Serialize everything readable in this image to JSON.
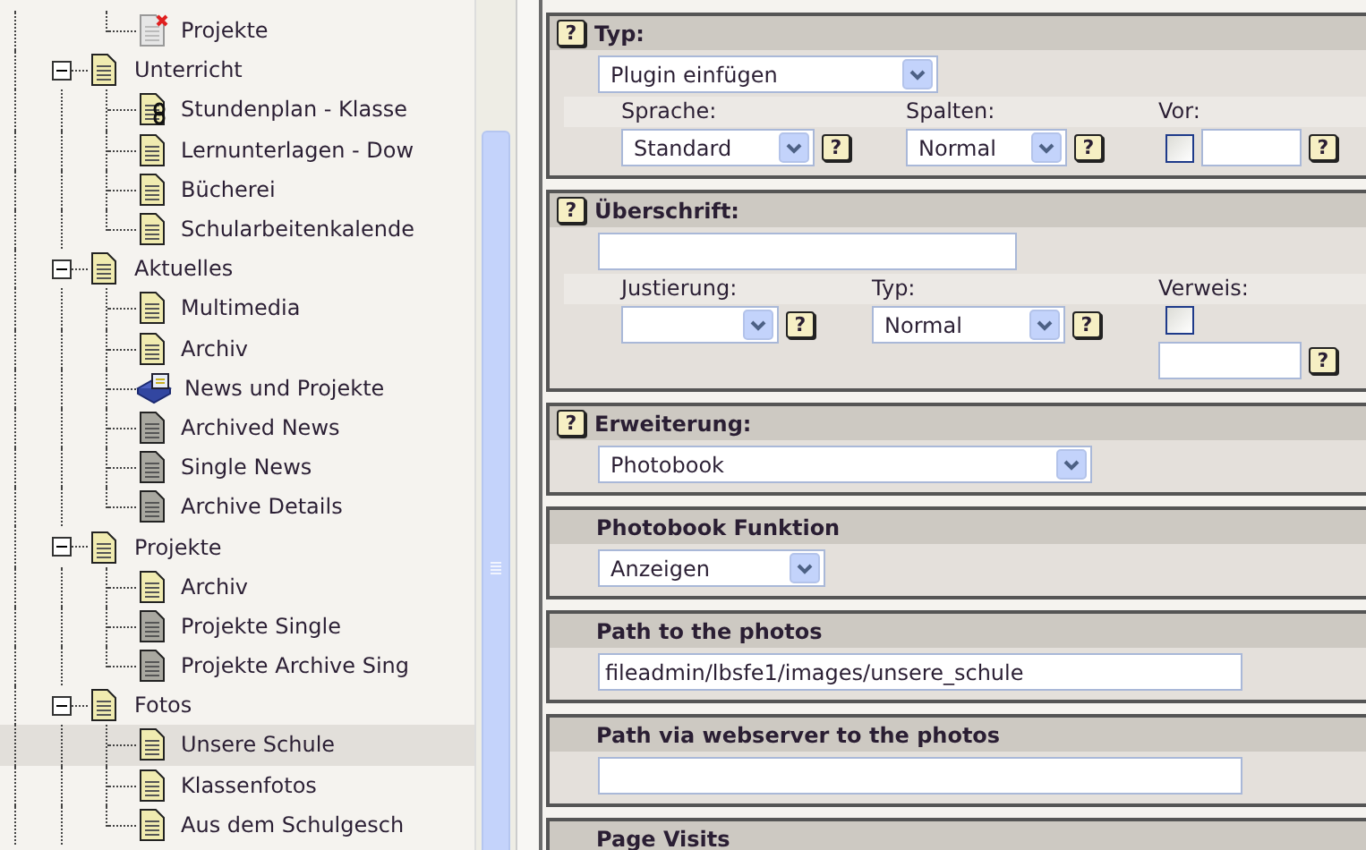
{
  "tree": {
    "continued_children": [
      {
        "label": "Projekte",
        "kind": "page-deleted",
        "selected": false
      }
    ],
    "items": [
      {
        "label": "Unterricht",
        "kind": "page",
        "expanded": true,
        "selected": false,
        "children": [
          {
            "label": "Stundenplan - Klasse",
            "kind": "page-link",
            "selected": false
          },
          {
            "label": "Lernunterlagen - Dow",
            "kind": "page",
            "selected": false
          },
          {
            "label": "Bücherei",
            "kind": "page",
            "selected": false
          },
          {
            "label": "Schularbeitenkalende",
            "kind": "page",
            "selected": false
          }
        ]
      },
      {
        "label": "Aktuelles",
        "kind": "page",
        "expanded": true,
        "selected": false,
        "children": [
          {
            "label": "Multimedia",
            "kind": "page",
            "selected": false
          },
          {
            "label": "Archiv",
            "kind": "page",
            "selected": false
          },
          {
            "label": "News und Projekte",
            "kind": "plugin",
            "selected": false
          },
          {
            "label": "Archived News",
            "kind": "page-gray",
            "selected": false
          },
          {
            "label": "Single News",
            "kind": "page-gray",
            "selected": false
          },
          {
            "label": "Archive Details",
            "kind": "page-gray",
            "selected": false
          }
        ]
      },
      {
        "label": "Projekte",
        "kind": "page",
        "expanded": true,
        "selected": false,
        "children": [
          {
            "label": "Archiv",
            "kind": "page",
            "selected": false
          },
          {
            "label": "Projekte Single",
            "kind": "page-gray",
            "selected": false
          },
          {
            "label": "Projekte Archive Sing",
            "kind": "page-gray",
            "selected": false
          }
        ]
      },
      {
        "label": "Fotos",
        "kind": "page",
        "expanded": true,
        "selected": false,
        "children": [
          {
            "label": "Unsere Schule",
            "kind": "page",
            "selected": true
          },
          {
            "label": "Klassenfotos",
            "kind": "page",
            "selected": false
          },
          {
            "label": "Aus dem Schulgesch",
            "kind": "page",
            "selected": false
          }
        ]
      }
    ]
  },
  "sections": [
    {
      "title": "Typ:",
      "help": "?",
      "main": {
        "kind": "select",
        "value": "Plugin einfügen"
      },
      "fields": [
        {
          "label": "Sprache:",
          "kind": "select",
          "value": "Standard",
          "help": "?"
        },
        {
          "label": "Spalten:",
          "kind": "select",
          "value": "Normal",
          "help": "?"
        },
        {
          "label": "Vor:",
          "kind": "check-text",
          "checked": false,
          "help": "?"
        }
      ]
    },
    {
      "title": "Überschrift:",
      "help": "?",
      "main": {
        "kind": "text"
      },
      "fields": [
        {
          "label": "Justierung:",
          "kind": "select",
          "help": "?"
        },
        {
          "label": "Typ:",
          "kind": "select",
          "value": "Normal",
          "help": "?"
        },
        {
          "label": "Verweis:",
          "kind": "check-text",
          "checked": false,
          "help": "?"
        }
      ]
    },
    {
      "title": "Erweiterung:",
      "help": "?",
      "main": {
        "kind": "select",
        "value": "Photobook"
      }
    },
    {
      "title": "Photobook Funktion",
      "main": {
        "kind": "select",
        "value": "Anzeigen"
      }
    },
    {
      "title": "Path to the photos",
      "main": {
        "kind": "text",
        "value": "fileadmin/lbsfe1/images/unsere_schule"
      }
    },
    {
      "title": "Path via webserver to the photos",
      "main": {
        "kind": "text"
      }
    },
    {
      "title": "Page Visits"
    }
  ]
}
